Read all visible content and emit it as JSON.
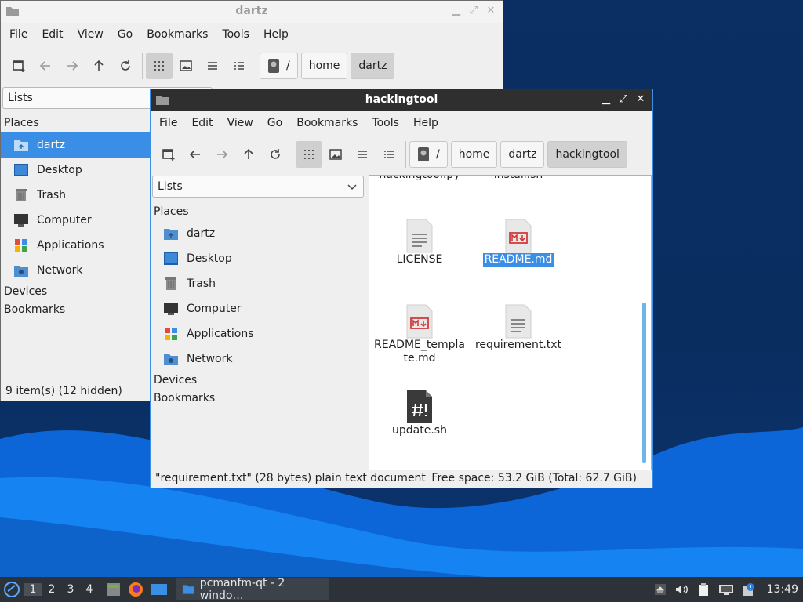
{
  "back_window": {
    "title": "dartz",
    "menu": [
      "File",
      "Edit",
      "View",
      "Go",
      "Bookmarks",
      "Tools",
      "Help"
    ],
    "breadcrumb": [
      "/",
      "home",
      "dartz"
    ],
    "view_mode": "Lists",
    "places_label": "Places",
    "places": [
      "dartz",
      "Desktop",
      "Trash",
      "Computer",
      "Applications",
      "Network"
    ],
    "devices_label": "Devices",
    "bookmarks_label": "Bookmarks",
    "status": "9 item(s) (12 hidden)"
  },
  "front_window": {
    "title": "hackingtool",
    "menu": [
      "File",
      "Edit",
      "View",
      "Go",
      "Bookmarks",
      "Tools",
      "Help"
    ],
    "breadcrumb": [
      "/",
      "home",
      "dartz",
      "hackingtool"
    ],
    "view_mode": "Lists",
    "places_label": "Places",
    "places": [
      "dartz",
      "Desktop",
      "Trash",
      "Computer",
      "Applications",
      "Network"
    ],
    "devices_label": "Devices",
    "bookmarks_label": "Bookmarks",
    "files_partial": [
      "hackingtool.py",
      "install.sh"
    ],
    "files": [
      {
        "name": "LICENSE",
        "icon": "text-file-icon"
      },
      {
        "name": "README.md",
        "icon": "markdown-file-icon",
        "selected": true
      },
      {
        "name": "README_template.md",
        "icon": "markdown-file-icon",
        "line1": "README_templa",
        "line2": "te.md"
      },
      {
        "name": "requirement.txt",
        "icon": "text-file-icon"
      },
      {
        "name": "update.sh",
        "icon": "shell-script-icon"
      }
    ],
    "status_left": "\"requirement.txt\" (28 bytes) plain text document",
    "status_right": "Free space: 53.2 GiB (Total: 62.7 GiB)"
  },
  "taskbar": {
    "workspaces": [
      "1",
      "2",
      "3",
      "4"
    ],
    "current_workspace": "1",
    "task_label": "pcmanfm-qt - 2 windo…",
    "clock": "13:49"
  },
  "colors": {
    "selection": "#3b8ee6",
    "titlebar": "#2f2f2f",
    "taskbar": "#2d3238"
  }
}
